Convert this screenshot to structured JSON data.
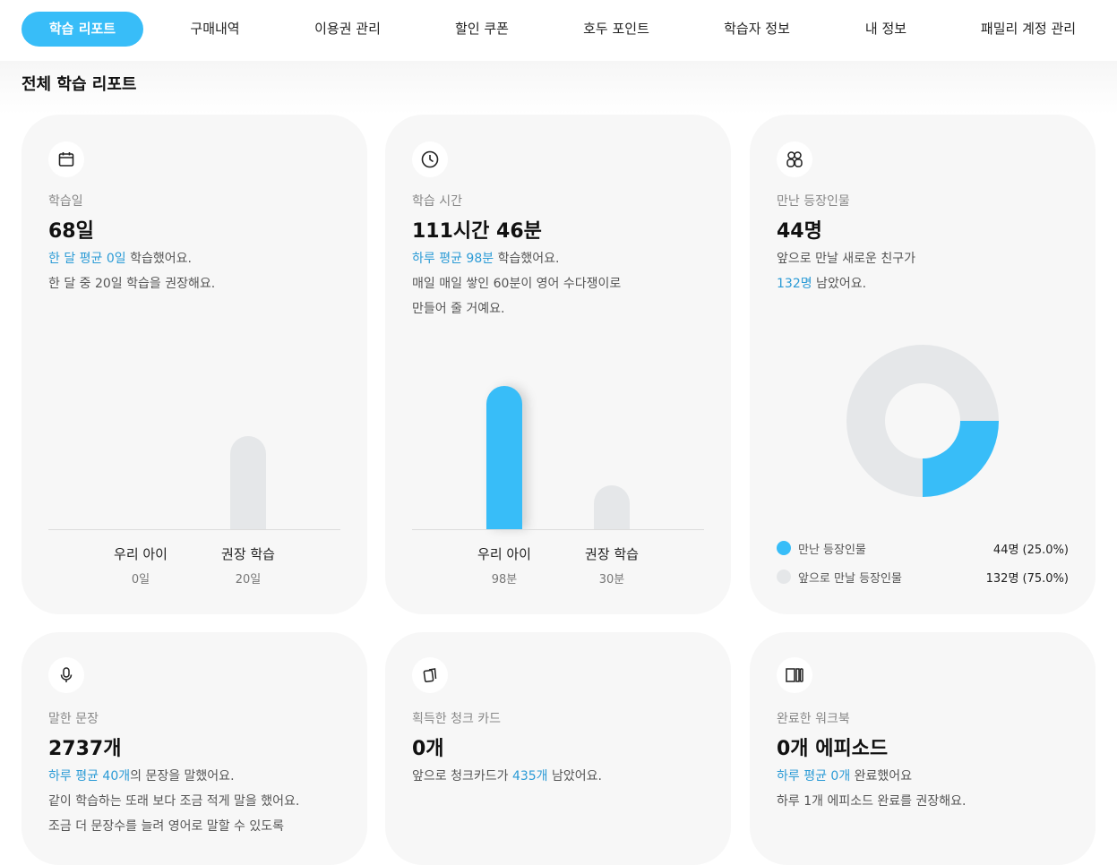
{
  "nav": {
    "tabs": [
      {
        "label": "학습 리포트",
        "active": true
      },
      {
        "label": "구매내역"
      },
      {
        "label": "이용권 관리"
      },
      {
        "label": "할인 쿠폰"
      },
      {
        "label": "호두 포인트"
      },
      {
        "label": "학습자 정보"
      },
      {
        "label": "내 정보"
      },
      {
        "label": "패밀리 계정 관리"
      }
    ]
  },
  "page_title": "전체 학습 리포트",
  "colors": {
    "accent": "#38bdf8",
    "highlight_text": "#2b9bd6",
    "card_bg": "#f7f7f7",
    "muted_bar": "#e5e7e9"
  },
  "cards": {
    "study_days": {
      "icon": "calendar-icon",
      "label": "학습일",
      "value": "68일",
      "line1_hl": "한 달 평균 0일",
      "line1_rest": " 학습했어요.",
      "line2": "한 달 중 20일 학습을 권장해요.",
      "bars": [
        {
          "name": "우리 아이",
          "value_text": "0일",
          "value": 0
        },
        {
          "name": "권장 학습",
          "value_text": "20일",
          "value": 20
        }
      ]
    },
    "study_time": {
      "icon": "clock-icon",
      "label": "학습 시간",
      "value": "111시간 46분",
      "line1_hl": "하루 평균 98분",
      "line1_rest": " 학습했어요.",
      "line2": "매일 매일 쌓인 60분이 영어 수다쟁이로",
      "line3": "만들어 줄 거예요.",
      "bars": [
        {
          "name": "우리 아이",
          "value_text": "98분",
          "value": 98
        },
        {
          "name": "권장 학습",
          "value_text": "30분",
          "value": 30
        }
      ]
    },
    "characters": {
      "icon": "characters-icon",
      "label": "만난 등장인물",
      "value": "44명",
      "line1": "앞으로 만날 새로운 친구가",
      "line2_hl": "132명",
      "line2_rest": " 남았어요.",
      "chart_data": {
        "type": "pie",
        "categories": [
          "만난 등장인물",
          "앞으로 만날 등장인물"
        ],
        "values": [
          44,
          132
        ],
        "percent": [
          25.0,
          75.0
        ]
      },
      "legend": [
        {
          "name": "만난 등장인물",
          "value_text": "44명 (25.0%)",
          "color": "#38bdf8"
        },
        {
          "name": "앞으로 만날 등장인물",
          "value_text": "132명 (75.0%)",
          "color": "#e5e7e9"
        }
      ]
    },
    "sentences": {
      "icon": "microphone-icon",
      "label": "말한 문장",
      "value": "2737개",
      "line1_hl": "하루 평균 40개",
      "line1_rest": "의 문장을 말했어요.",
      "line2": "같이 학습하는 또래 보다 조금 적게 말을 했어요.",
      "line3": "조금 더 문장수를 늘려 영어로 말할 수 있도록"
    },
    "chunk_cards": {
      "icon": "cards-icon",
      "label": "획득한 청크 카드",
      "value": "0개",
      "line1_pre": "앞으로 청크카드가 ",
      "line1_hl": "435개",
      "line1_rest": " 남았어요."
    },
    "workbook": {
      "icon": "workbook-icon",
      "label": "완료한 워크북",
      "value": "0개 에피소드",
      "line1_hl": "하루 평균 0개",
      "line1_rest": " 완료했어요",
      "line2": "하루 1개 에피소드 완료를 권장해요."
    }
  }
}
